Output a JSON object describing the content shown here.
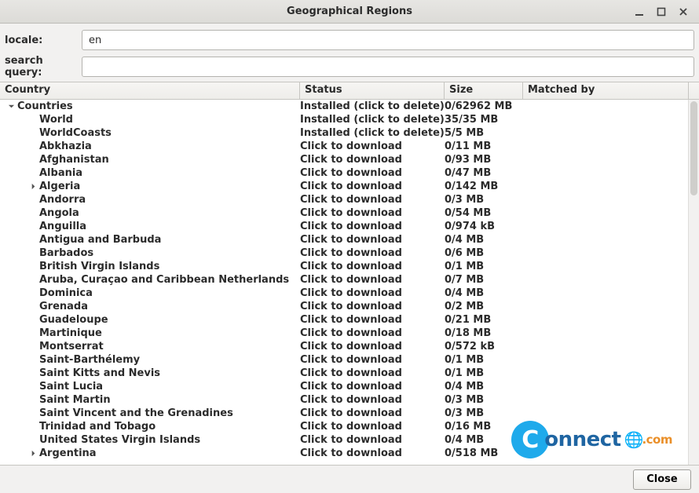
{
  "window": {
    "title": "Geographical Regions"
  },
  "form": {
    "locale_label": "locale:",
    "locale_value": "en",
    "search_label": "search query:",
    "search_value": ""
  },
  "columns": {
    "country": "Country",
    "status": "Status",
    "size": "Size",
    "matched": "Matched by"
  },
  "rows": [
    {
      "indent": 0,
      "expander": "down",
      "bold": true,
      "country": "Countries",
      "status": "Installed (click to delete)",
      "size": "0/62962 MB"
    },
    {
      "indent": 1,
      "expander": "",
      "bold": true,
      "country": "World",
      "status": "Installed (click to delete)",
      "size": "35/35 MB"
    },
    {
      "indent": 1,
      "expander": "",
      "bold": true,
      "country": "WorldCoasts",
      "status": "Installed (click to delete)",
      "size": "5/5 MB"
    },
    {
      "indent": 1,
      "expander": "",
      "bold": true,
      "country": "Abkhazia",
      "status": "Click to download",
      "size": "0/11 MB"
    },
    {
      "indent": 1,
      "expander": "",
      "bold": true,
      "country": "Afghanistan",
      "status": "Click to download",
      "size": "0/93 MB"
    },
    {
      "indent": 1,
      "expander": "",
      "bold": true,
      "country": "Albania",
      "status": "Click to download",
      "size": "0/47 MB"
    },
    {
      "indent": 1,
      "expander": "right",
      "bold": true,
      "country": "Algeria",
      "status": "Click to download",
      "size": "0/142 MB"
    },
    {
      "indent": 1,
      "expander": "",
      "bold": true,
      "country": "Andorra",
      "status": "Click to download",
      "size": "0/3 MB"
    },
    {
      "indent": 1,
      "expander": "",
      "bold": true,
      "country": "Angola",
      "status": "Click to download",
      "size": "0/54 MB"
    },
    {
      "indent": 1,
      "expander": "",
      "bold": true,
      "country": "Anguilla",
      "status": "Click to download",
      "size": "0/974 kB"
    },
    {
      "indent": 1,
      "expander": "",
      "bold": true,
      "country": "Antigua and Barbuda",
      "status": "Click to download",
      "size": "0/4 MB"
    },
    {
      "indent": 1,
      "expander": "",
      "bold": true,
      "country": "Barbados",
      "status": "Click to download",
      "size": "0/6 MB"
    },
    {
      "indent": 1,
      "expander": "",
      "bold": true,
      "country": "British Virgin Islands",
      "status": "Click to download",
      "size": "0/1 MB"
    },
    {
      "indent": 1,
      "expander": "",
      "bold": true,
      "country": "Aruba, Curaçao and Caribbean Netherlands",
      "status": "Click to download",
      "size": "0/7 MB"
    },
    {
      "indent": 1,
      "expander": "",
      "bold": true,
      "country": "Dominica",
      "status": "Click to download",
      "size": "0/4 MB"
    },
    {
      "indent": 1,
      "expander": "",
      "bold": true,
      "country": "Grenada",
      "status": "Click to download",
      "size": "0/2 MB"
    },
    {
      "indent": 1,
      "expander": "",
      "bold": true,
      "country": "Guadeloupe",
      "status": "Click to download",
      "size": "0/21 MB"
    },
    {
      "indent": 1,
      "expander": "",
      "bold": true,
      "country": "Martinique",
      "status": "Click to download",
      "size": "0/18 MB"
    },
    {
      "indent": 1,
      "expander": "",
      "bold": true,
      "country": "Montserrat",
      "status": "Click to download",
      "size": "0/572 kB"
    },
    {
      "indent": 1,
      "expander": "",
      "bold": true,
      "country": "Saint-Barthélemy",
      "status": "Click to download",
      "size": "0/1 MB"
    },
    {
      "indent": 1,
      "expander": "",
      "bold": true,
      "country": "Saint Kitts and Nevis",
      "status": "Click to download",
      "size": "0/1 MB"
    },
    {
      "indent": 1,
      "expander": "",
      "bold": true,
      "country": "Saint Lucia",
      "status": "Click to download",
      "size": "0/4 MB"
    },
    {
      "indent": 1,
      "expander": "",
      "bold": true,
      "country": "Saint Martin",
      "status": "Click to download",
      "size": "0/3 MB"
    },
    {
      "indent": 1,
      "expander": "",
      "bold": true,
      "country": "Saint Vincent and the Grenadines",
      "status": "Click to download",
      "size": "0/3 MB"
    },
    {
      "indent": 1,
      "expander": "",
      "bold": true,
      "country": "Trinidad and Tobago",
      "status": "Click to download",
      "size": "0/16 MB"
    },
    {
      "indent": 1,
      "expander": "",
      "bold": true,
      "country": "United States Virgin Islands",
      "status": "Click to download",
      "size": "0/4 MB"
    },
    {
      "indent": 1,
      "expander": "right",
      "bold": true,
      "country": "Argentina",
      "status": "Click to download",
      "size": "0/518 MB"
    }
  ],
  "footer": {
    "close_label": "Close"
  },
  "watermark": {
    "text": "onnect",
    "suffix": ".com"
  }
}
